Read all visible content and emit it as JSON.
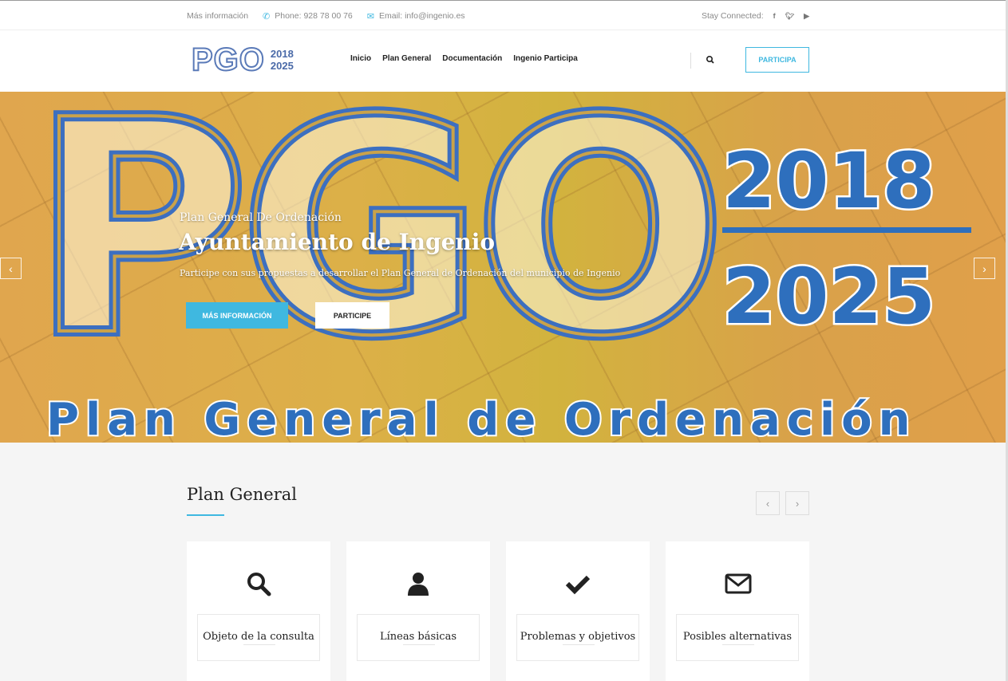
{
  "topbar": {
    "info": "Más información",
    "phone": "Phone: 928 78 00 76",
    "email": "Email: info@ingenio.es",
    "stay_connected": "Stay Connected:",
    "social": [
      "f",
      "t",
      "yt"
    ]
  },
  "header": {
    "logo_text": "PGO",
    "logo_year1": "2018",
    "logo_year2": "2025",
    "nav": [
      "Inicio",
      "Plan General",
      "Documentación",
      "Ingenio Participa"
    ],
    "cta": "PARTICIPA"
  },
  "hero": {
    "bg_big": "PGO",
    "bg_year1": "2018",
    "bg_year2": "2025",
    "bg_footer": "Plan General de Ordenación",
    "subtitle": "Plan General De Ordenación",
    "title": "Ayuntamiento de Ingenio",
    "description": "Participe con sus propuestas a desarrollar el Plan General de Ordenación del municipio de Ingenio",
    "btn_info": "MÁS INFORMACIÓN",
    "btn_participe": "PARTICIPE",
    "prev": "‹",
    "next": "›"
  },
  "section": {
    "title": "Plan General",
    "prev": "‹",
    "next": "›",
    "cards": [
      {
        "icon": "search-icon",
        "label": "Objeto de la consulta"
      },
      {
        "icon": "user-icon",
        "label": "Líneas básicas"
      },
      {
        "icon": "check-icon",
        "label": "Problemas y objetivos"
      },
      {
        "icon": "envelope-icon",
        "label": "Posibles alternativas"
      }
    ]
  },
  "colors": {
    "accent": "#3fb8e0",
    "logo_blue": "#4a6aa8",
    "hero_blue": "#3c6fc0"
  }
}
